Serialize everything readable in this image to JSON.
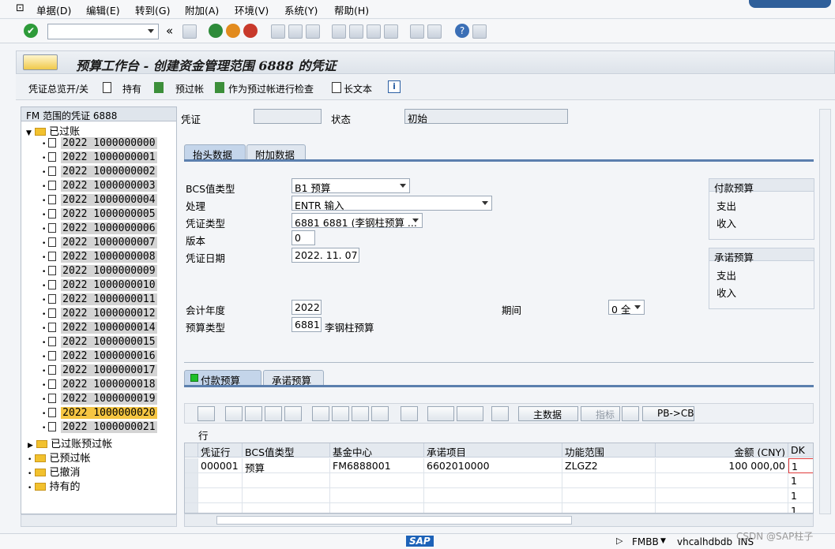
{
  "menu": [
    "单据(D)",
    "编辑(E)",
    "转到(G)",
    "附加(A)",
    "环境(V)",
    "系统(Y)",
    "帮助(H)"
  ],
  "toolbar": {
    "command_value": "",
    "collapse": "«"
  },
  "title": "预算工作台 - 创建资金管理范围 6888 的凭证",
  "appbar": {
    "doc_overview": "凭证总览开/关",
    "hold": "持有",
    "park": "预过帐",
    "check_park": "作为预过帐进行检查",
    "long_text": "长文本"
  },
  "tree": {
    "header": "FM 范围的凭证 6888",
    "posted_label": "已过账",
    "docs": [
      "2022 1000000000",
      "2022 1000000001",
      "2022 1000000002",
      "2022 1000000003",
      "2022 1000000004",
      "2022 1000000005",
      "2022 1000000006",
      "2022 1000000007",
      "2022 1000000008",
      "2022 1000000009",
      "2022 1000000010",
      "2022 1000000011",
      "2022 1000000012",
      "2022 1000000014",
      "2022 1000000015",
      "2022 1000000016",
      "2022 1000000017",
      "2022 1000000018",
      "2022 1000000019",
      "2022 1000000020",
      "2022 1000000021"
    ],
    "selected_index": 19,
    "folders": [
      "已过账预过帐",
      "已预过帐",
      "已撤消",
      "持有的"
    ]
  },
  "header": {
    "doc_label": "凭证",
    "doc_value": "",
    "status_label": "状态",
    "status_value": "初始"
  },
  "tabs_top": [
    "抬头数据",
    "附加数据"
  ],
  "form": {
    "bcs_label": "BCS值类型",
    "bcs_value": "B1 预算",
    "process_label": "处理",
    "process_value": "ENTR 输入",
    "doctype_label": "凭证类型",
    "doctype_value": "6881 6881 (李钢柱预算 ...",
    "version_label": "版本",
    "version_value": "0",
    "docdate_label": "凭证日期",
    "docdate_value": "2022. 11. 07",
    "fy_label": "会计年度",
    "fy_value": "2022",
    "period_label": "期间",
    "period_value": "0 全",
    "budtype_label": "预算类型",
    "budtype_value": "6881",
    "budtype_text": "李钢柱预算"
  },
  "payment_budget": {
    "title": "付款预算",
    "rows": [
      "支出",
      "收入"
    ]
  },
  "commit_budget": {
    "title": "承诺预算",
    "rows": [
      "支出",
      "收入"
    ]
  },
  "tabs_bottom": [
    "付款预算",
    "承诺预算"
  ],
  "grid_toolbar": {
    "main_data": "主数据",
    "indicator": "指标",
    "pb_cb": "PB->CB"
  },
  "row_label": "行",
  "grid": {
    "columns": [
      "凭证行",
      "BCS值类型",
      "基金中心",
      "承诺项目",
      "功能范围",
      "金额 (CNY)",
      "DK"
    ],
    "rows": [
      {
        "line": "000001",
        "bcs": "预算",
        "fund": "FM6888001",
        "commit": "6602010000",
        "func": "ZLGZ2",
        "amount": "100 000,00",
        "dk": "1"
      },
      {
        "line": "",
        "bcs": "",
        "fund": "",
        "commit": "",
        "func": "",
        "amount": "",
        "dk": "1"
      },
      {
        "line": "",
        "bcs": "",
        "fund": "",
        "commit": "",
        "func": "",
        "amount": "",
        "dk": "1"
      },
      {
        "line": "",
        "bcs": "",
        "fund": "",
        "commit": "",
        "func": "",
        "amount": "",
        "dk": "1"
      }
    ]
  },
  "status": {
    "tcode": "FMBB",
    "server": "vhcalhdbdb",
    "mode": "INS",
    "watermark": "CSDN @SAP柱子",
    "logo": "SAP"
  }
}
